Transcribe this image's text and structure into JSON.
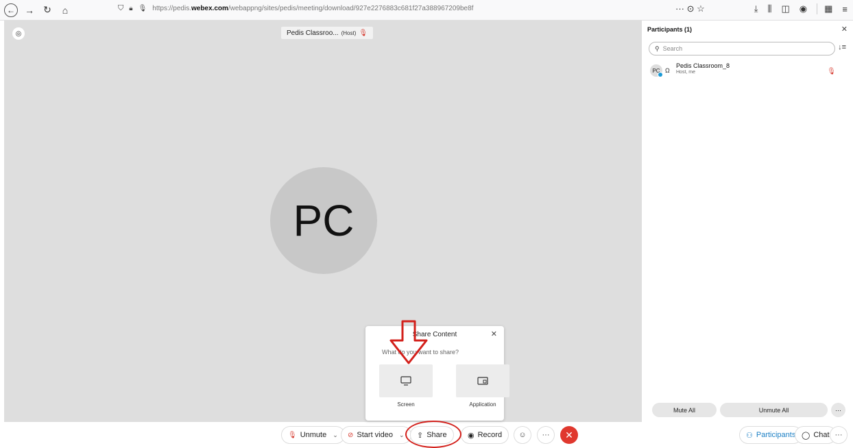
{
  "browser": {
    "url_prefix": "https://pedis.",
    "url_domain": "webex.com",
    "url_path": "/webappng/sites/pedis/meeting/download/927e2276883c681f27a388967209be8f",
    "page_actions": "··· ⊙ ☆"
  },
  "stage": {
    "name_label": "Pedis Classroo...",
    "host_tag": "(Host)",
    "avatar_initials": "PC"
  },
  "share_dialog": {
    "title": "Share Content",
    "question": "What do you want to share?",
    "options": [
      {
        "label": "Screen"
      },
      {
        "label": "Application"
      }
    ]
  },
  "controls": {
    "unmute": "Unmute",
    "start_video": "Start video",
    "share": "Share",
    "record": "Record",
    "more": "···",
    "participants": "Participants",
    "chat": "Chat",
    "panel_more": "···"
  },
  "panel": {
    "title": "Participants (1)",
    "search_placeholder": "Search",
    "participants": [
      {
        "initials": "PC",
        "name": "Pedis Classroom_8",
        "role": "Host, me"
      }
    ],
    "mute_all": "Mute All",
    "unmute_all": "Unmute All",
    "more": "···"
  },
  "colors": {
    "accent_red": "#d3201b",
    "leave_red": "#e0382e",
    "link_blue": "#1b7fc4"
  }
}
